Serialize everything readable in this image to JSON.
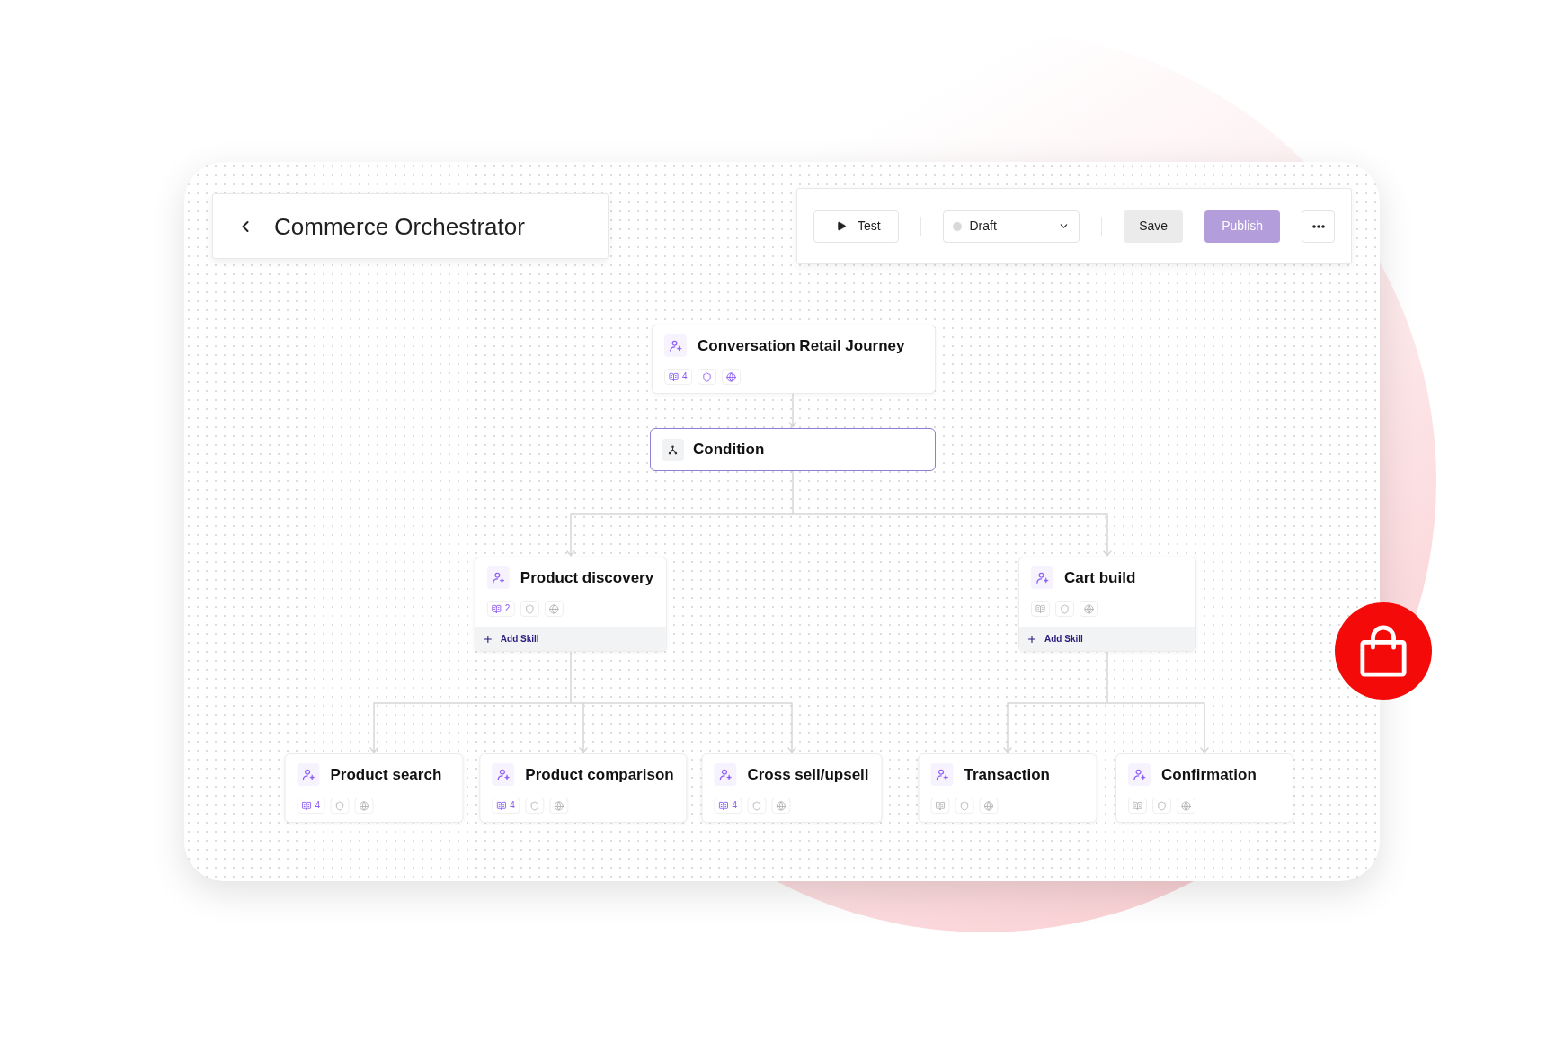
{
  "header": {
    "title": "Commerce Orchestrator"
  },
  "toolbar": {
    "test_button": "Test",
    "status": {
      "label": "Draft",
      "color": "#d9d9d9"
    },
    "save_button": "Save",
    "publish_button": "Publish"
  },
  "flow": {
    "nodes": [
      {
        "kind": "agent",
        "title": "Conversation Retail Journey",
        "selected": false,
        "badges": [
          {
            "kind": "book",
            "count": "4",
            "active": true
          },
          {
            "kind": "shield",
            "active": true
          },
          {
            "kind": "globe",
            "active": true
          }
        ],
        "children": [
          {
            "kind": "condition",
            "title": "Condition",
            "selected": true,
            "children": [
              {
                "kind": "agent",
                "title": "Product discovery",
                "selected": false,
                "badges": [
                  {
                    "kind": "book",
                    "count": "2",
                    "active": true
                  },
                  {
                    "kind": "shield",
                    "active": false
                  },
                  {
                    "kind": "globe",
                    "active": false
                  }
                ],
                "add_skill": "Add Skill",
                "children": [
                  {
                    "kind": "agent",
                    "title": "Product search",
                    "selected": false,
                    "badges": [
                      {
                        "kind": "book",
                        "count": "4",
                        "active": true
                      },
                      {
                        "kind": "shield",
                        "active": false
                      },
                      {
                        "kind": "globe",
                        "active": false
                      }
                    ]
                  },
                  {
                    "kind": "agent",
                    "title": "Product comparison",
                    "selected": false,
                    "badges": [
                      {
                        "kind": "book",
                        "count": "4",
                        "active": true
                      },
                      {
                        "kind": "shield",
                        "active": false
                      },
                      {
                        "kind": "globe",
                        "active": false
                      }
                    ]
                  },
                  {
                    "kind": "agent",
                    "title": "Cross sell/upsell",
                    "selected": false,
                    "badges": [
                      {
                        "kind": "book",
                        "count": "4",
                        "active": true
                      },
                      {
                        "kind": "shield",
                        "active": false
                      },
                      {
                        "kind": "globe",
                        "active": false
                      }
                    ]
                  }
                ]
              },
              {
                "kind": "agent",
                "title": "Cart build",
                "selected": false,
                "badges": [
                  {
                    "kind": "book",
                    "active": false
                  },
                  {
                    "kind": "shield",
                    "active": false
                  },
                  {
                    "kind": "globe",
                    "active": false
                  }
                ],
                "add_skill": "Add Skill",
                "children": [
                  {
                    "kind": "agent",
                    "title": "Transaction",
                    "selected": false,
                    "badges": [
                      {
                        "kind": "book",
                        "active": false
                      },
                      {
                        "kind": "shield",
                        "active": false
                      },
                      {
                        "kind": "globe",
                        "active": false
                      }
                    ]
                  },
                  {
                    "kind": "agent",
                    "title": "Confirmation",
                    "selected": false,
                    "badges": [
                      {
                        "kind": "book",
                        "active": false
                      },
                      {
                        "kind": "shield",
                        "active": false
                      },
                      {
                        "kind": "globe",
                        "active": false
                      }
                    ]
                  }
                ]
              }
            ]
          }
        ]
      }
    ]
  }
}
